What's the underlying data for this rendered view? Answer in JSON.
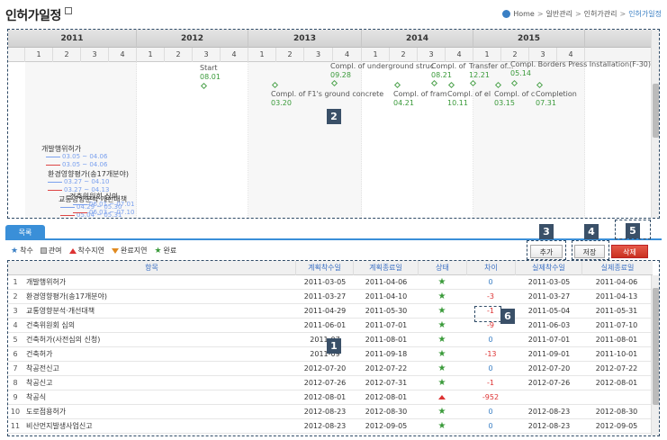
{
  "page": {
    "title": "인허가일정",
    "breadcrumb": [
      "Home",
      "일반관리",
      "인허가관리",
      "인허가일정"
    ]
  },
  "gantt": {
    "years": [
      "2011",
      "2012",
      "2013",
      "2014",
      "2015"
    ],
    "quarters": [
      "1",
      "2",
      "3",
      "4"
    ],
    "milestones": [
      {
        "label": "Start",
        "date": "08.01"
      },
      {
        "label": "Compl. of underground struc",
        "date": "09.28"
      },
      {
        "label": "Compl. of F1's ground concrete",
        "date": "03.20"
      },
      {
        "label": "Compl. of fram",
        "date": "04.21"
      },
      {
        "label": "Compl. of",
        "date": "08.21"
      },
      {
        "label": "Compl. of el",
        "date": "10.11"
      },
      {
        "label": "Transfer of...",
        "date": "12.21"
      },
      {
        "label": "Compl. of c",
        "date": "03.15"
      },
      {
        "label": "Compl. Borders Press Installation(F-30)",
        "date": "05.14"
      },
      {
        "label": "Completion",
        "date": "07.31"
      }
    ],
    "activities": [
      {
        "name": "개발행위허가",
        "plan": "03.05 ~ 04.06",
        "actual": "03.05 ~ 04.06"
      },
      {
        "name": "환경영향평가(송17개분야)",
        "plan": "03.27 ~ 04.10",
        "actual": "03.27 ~ 04.13"
      },
      {
        "name": "교통영향분석·개선대책",
        "plan": "04.29 ~ 05.30",
        "actual": "05.04 ~ 05.31"
      },
      {
        "name": "건축위원회 심의",
        "plan": "06.01 ~ 07.01",
        "actual": "06.03 ~ 07.10"
      }
    ]
  },
  "tabs": [
    {
      "label": "목록"
    }
  ],
  "legend": [
    {
      "label": "착수",
      "icon": "star-blue"
    },
    {
      "label": "관여",
      "icon": "square-gray"
    },
    {
      "label": "착수지연",
      "icon": "triangle-red"
    },
    {
      "label": "완료지연",
      "icon": "triangle-orange"
    },
    {
      "label": "완료",
      "icon": "star-green"
    }
  ],
  "toolbar": {
    "add_label": "추가",
    "save_label": "저장",
    "delete_label": "삭제"
  },
  "table": {
    "headers": [
      "항목",
      "계획착수일",
      "계획종료일",
      "상태",
      "차이",
      "실제착수일",
      "실제종료일"
    ],
    "rows": [
      {
        "no": "1",
        "name": "개발행위허가",
        "plan_start": "2011-03-05",
        "plan_end": "2011-04-06",
        "status": "star",
        "diff": "0",
        "act_start": "2011-03-05",
        "act_end": "2011-04-06"
      },
      {
        "no": "2",
        "name": "환경영향평가(송17개분야)",
        "plan_start": "2011-03-27",
        "plan_end": "2011-04-10",
        "status": "star",
        "diff": "-3",
        "act_start": "2011-03-27",
        "act_end": "2011-04-13"
      },
      {
        "no": "3",
        "name": "교통영향분석·개선대책",
        "plan_start": "2011-04-29",
        "plan_end": "2011-05-30",
        "status": "star",
        "diff": "-1",
        "act_start": "2011-05-04",
        "act_end": "2011-05-31"
      },
      {
        "no": "4",
        "name": "건축위원회 심의",
        "plan_start": "2011-06-01",
        "plan_end": "2011-07-01",
        "status": "star",
        "diff": "-9",
        "act_start": "2011-06-03",
        "act_end": "2011-07-10"
      },
      {
        "no": "5",
        "name": "건축허가(사전심의 신청)",
        "plan_start": "2011-07",
        "plan_end": "2011-08-01",
        "status": "star",
        "diff": "0",
        "act_start": "2011-07-01",
        "act_end": "2011-08-01"
      },
      {
        "no": "6",
        "name": "건축허가",
        "plan_start": "2011-09",
        "plan_end": "2011-09-18",
        "status": "star",
        "diff": "-13",
        "act_start": "2011-09-01",
        "act_end": "2011-10-01"
      },
      {
        "no": "7",
        "name": "착공전신고",
        "plan_start": "2012-07-20",
        "plan_end": "2012-07-22",
        "status": "star",
        "diff": "0",
        "act_start": "2012-07-20",
        "act_end": "2012-07-22"
      },
      {
        "no": "8",
        "name": "착공신고",
        "plan_start": "2012-07-26",
        "plan_end": "2012-07-31",
        "status": "star",
        "diff": "-1",
        "act_start": "2012-07-26",
        "act_end": "2012-08-01"
      },
      {
        "no": "9",
        "name": "착공식",
        "plan_start": "2012-08-01",
        "plan_end": "2012-08-01",
        "status": "triangle",
        "diff": "-952",
        "act_start": "",
        "act_end": ""
      },
      {
        "no": "10",
        "name": "도로점용허가",
        "plan_start": "2012-08-23",
        "plan_end": "2012-08-30",
        "status": "star",
        "diff": "0",
        "act_start": "2012-08-23",
        "act_end": "2012-08-30"
      },
      {
        "no": "11",
        "name": "비산먼지발생사업신고",
        "plan_start": "2012-08-23",
        "plan_end": "2012-09-05",
        "status": "star",
        "diff": "0",
        "act_start": "2012-08-23",
        "act_end": "2012-09-05"
      }
    ]
  },
  "callouts": [
    "1",
    "2",
    "3",
    "4",
    "5",
    "6"
  ]
}
